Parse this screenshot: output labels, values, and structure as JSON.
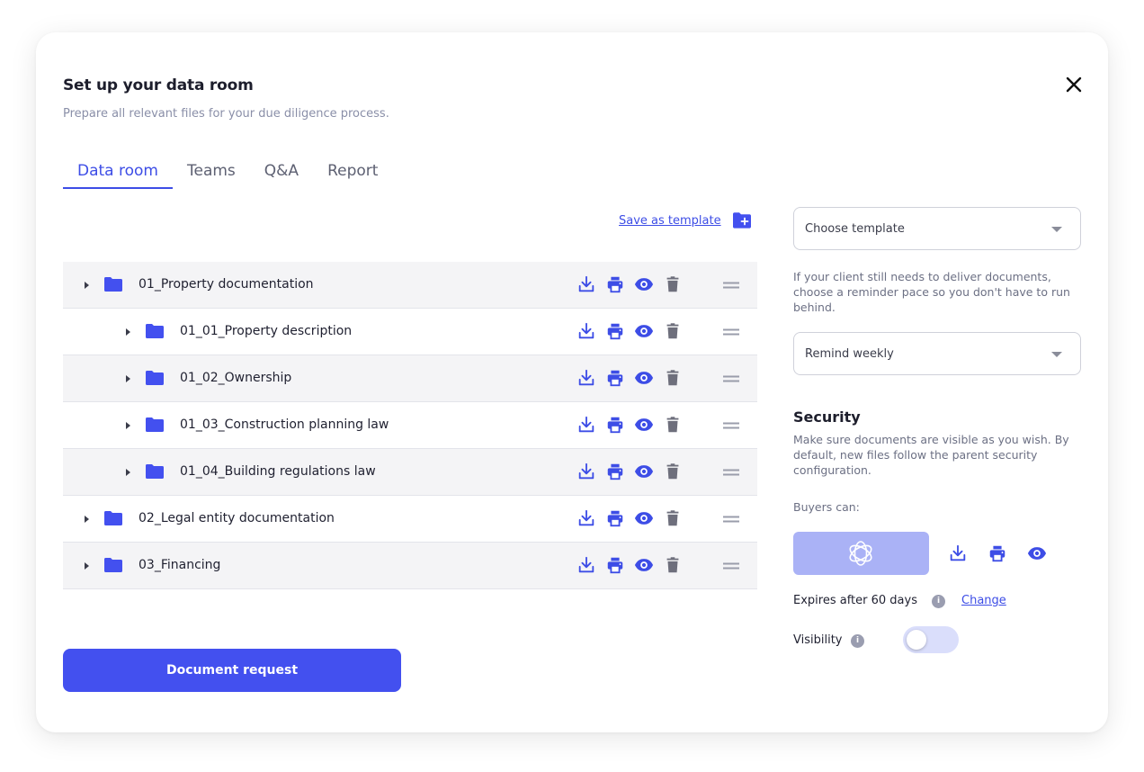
{
  "dialog": {
    "title": "Set up your data room",
    "subtitle": "Prepare all relevant files for your due diligence process."
  },
  "tabs": [
    {
      "label": "Data room",
      "active": true
    },
    {
      "label": "Teams",
      "active": false
    },
    {
      "label": "Q&A",
      "active": false
    },
    {
      "label": "Report",
      "active": false
    }
  ],
  "toolbar": {
    "save_template_label": "Save as template",
    "add_folder_icon": "folder-plus-icon"
  },
  "tree": {
    "rows": [
      {
        "label": "01_Property documentation",
        "level": 0
      },
      {
        "label": "01_01_Property description",
        "level": 1
      },
      {
        "label": "01_02_Ownership",
        "level": 1
      },
      {
        "label": "01_03_Construction planning law",
        "level": 1
      },
      {
        "label": "01_04_Building regulations law",
        "level": 1
      },
      {
        "label": "02_Legal entity documentation",
        "level": 0
      },
      {
        "label": "03_Financing",
        "level": 0
      }
    ],
    "row_actions": [
      "download-icon",
      "print-icon",
      "eye-icon",
      "trash-icon"
    ]
  },
  "primary_button": {
    "label": "Document request"
  },
  "settings": {
    "template_select": {
      "value": "Choose template"
    },
    "reminder_hint": "If your client still needs to deliver documents, choose a reminder pace so you don't have to run behind.",
    "reminder_select": {
      "value": "Remind weekly"
    },
    "security": {
      "title": "Security",
      "description": "Make sure documents are visible as you wish. By default, new files follow the parent security configuration.",
      "buyers_label": "Buyers can:",
      "expires_label": "Expires after 60 days",
      "change_link": "Change",
      "visibility_label": "Visibility",
      "visibility_on": false
    }
  },
  "colors": {
    "accent": "#3d4de6",
    "button": "#4350ef",
    "folder": "#4350ef",
    "muted_icon": "#6e6f7c",
    "row_alt": "#f4f4f6",
    "perm_box": "#aab2f6",
    "toggle_off": "#dadefb"
  }
}
